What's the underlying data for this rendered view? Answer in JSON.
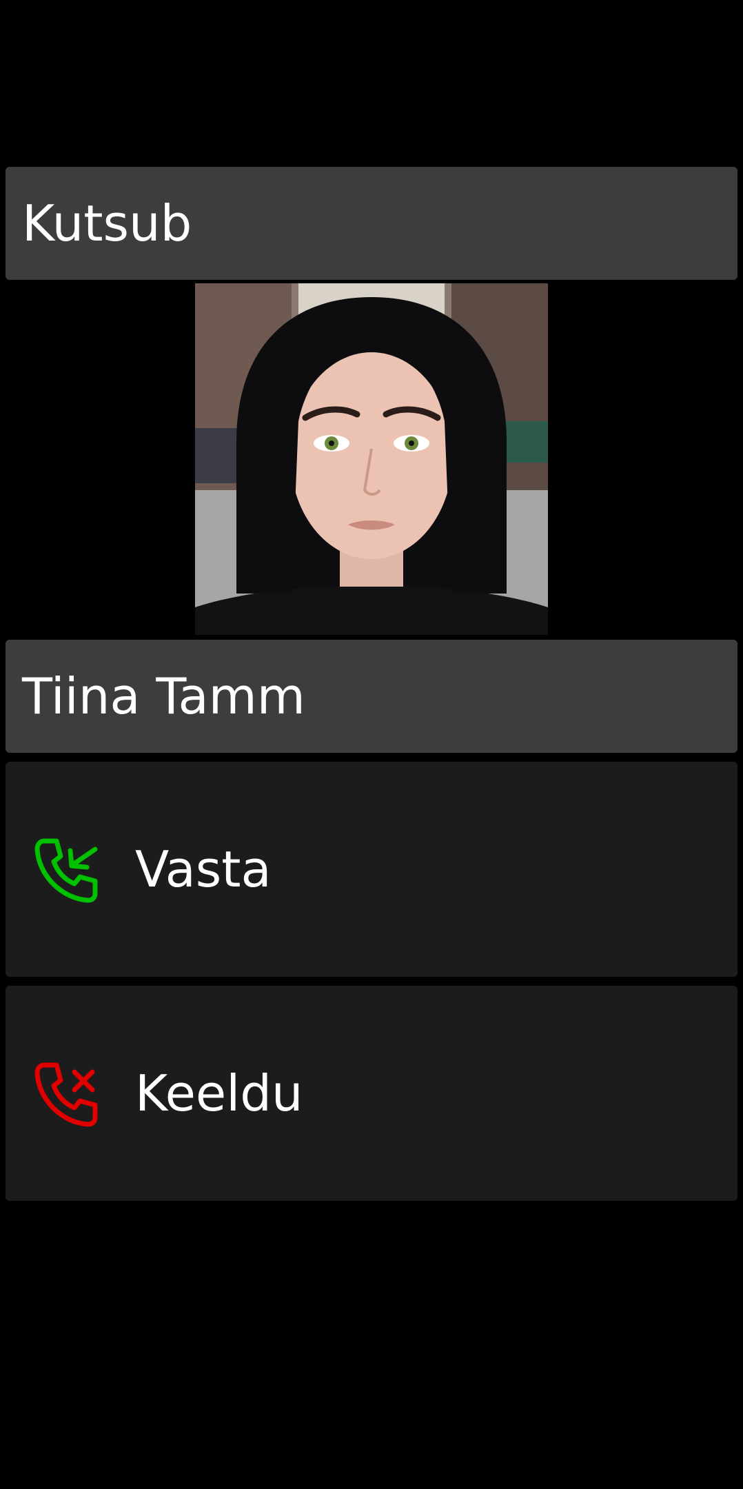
{
  "call": {
    "status_label": "Kutsub",
    "caller_name": "Tiina Tamm"
  },
  "actions": {
    "answer": {
      "label": "Vasta",
      "icon": "phone-incoming-icon",
      "color": "#00c000"
    },
    "decline": {
      "label": "Keeldu",
      "icon": "phone-missed-icon",
      "color": "#e00000"
    }
  },
  "colors": {
    "background": "#000000",
    "bar": "#3d3d3d",
    "action_bg": "#1c1c1c"
  }
}
